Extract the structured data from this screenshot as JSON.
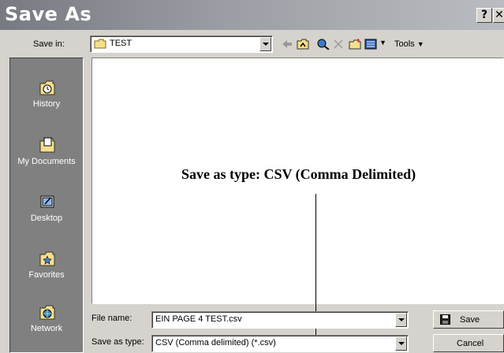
{
  "window": {
    "title": "Save As",
    "help_label": "?",
    "close_label": "✕"
  },
  "toolbar": {
    "save_in_label": "Save in:",
    "save_in_value": "TEST",
    "tools_label": "Tools"
  },
  "places": [
    {
      "label": "History",
      "icon": "history-icon"
    },
    {
      "label": "My Documents",
      "icon": "my-documents-icon"
    },
    {
      "label": "Desktop",
      "icon": "desktop-icon"
    },
    {
      "label": "Favorites",
      "icon": "favorites-icon"
    },
    {
      "label": "Network",
      "icon": "network-icon"
    }
  ],
  "annotation": {
    "text": "Save as type: CSV (Comma Delimited)"
  },
  "form": {
    "file_name_label": "File name:",
    "file_name_value": "EIN PAGE 4 TEST.csv",
    "save_type_label": "Save as type:",
    "save_type_value": "CSV (Comma delimited) (*.csv)"
  },
  "buttons": {
    "save": "Save",
    "cancel": "Cancel"
  },
  "colors": {
    "dialog_bg": "#d6d3ce",
    "places_bar": "#808080",
    "title_gradient_start": "#777a80"
  }
}
